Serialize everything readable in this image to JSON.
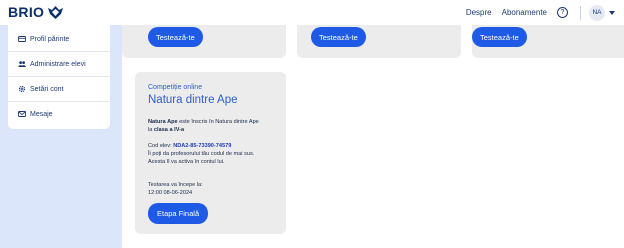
{
  "header": {
    "logo_text": "BRIO",
    "nav": {
      "despre": "Despre",
      "abonamente": "Abonamente",
      "help": "?",
      "avatar": "NA"
    }
  },
  "sidebar": {
    "items": [
      {
        "label": "Profil părinte",
        "icon": "card-icon"
      },
      {
        "label": "Administrare elevi",
        "icon": "users-icon"
      },
      {
        "label": "Setări cont",
        "icon": "gear-icon"
      },
      {
        "label": "Mesaje",
        "icon": "mail-icon"
      }
    ]
  },
  "top_cards": [
    {
      "button": "Testează-te"
    },
    {
      "button": "Testează-te"
    },
    {
      "button": "Testează-te"
    }
  ],
  "competition": {
    "label": "Competiție online",
    "title": "Natura dintre Ape",
    "line1_bold": "Natura Ape",
    "line1_rest": " este înscris în Natura dintre Ape",
    "line2_pre": "la ",
    "line2_bold": "clasa a IV-a",
    "code_label": "Cod elev: ",
    "code_value": "NDA2-85-73390-74579",
    "hint1": "Îi poți da profesorului tău codul de mai sus.",
    "hint2": "Acesta îl va activa în contul lui.",
    "start_label": "Testarea va începe la:",
    "start_time": "12:00 08-06-2024",
    "button": "Etapa Finală"
  },
  "colors": {
    "accent": "#1f5ae6",
    "sidebar_bg": "#dce6fb",
    "card_bg": "#ececec",
    "brand": "#0d2f6e"
  }
}
